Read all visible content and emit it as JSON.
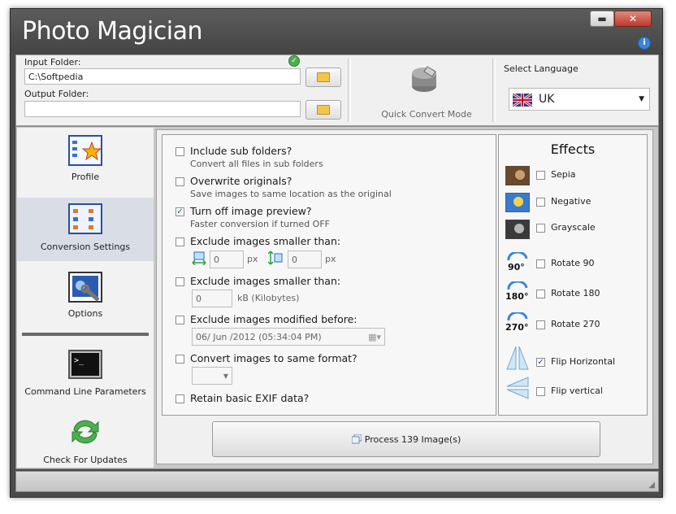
{
  "app": {
    "title": "Photo Magician"
  },
  "window_controls": {
    "minimize": "▬",
    "close": "✕",
    "info": "i"
  },
  "top": {
    "input_folder_label": "Input Folder:",
    "input_folder_value": "C:\\Softpedia",
    "output_folder_label": "Output Folder:",
    "output_folder_value": "",
    "quick_convert_label": "Quick Convert Mode",
    "language_label": "Select Language",
    "language_value": "UK"
  },
  "sidebar": {
    "items": [
      {
        "label": "Profile",
        "icon": "profile-icon",
        "active": false
      },
      {
        "label": "Conversion Settings",
        "icon": "conversion-settings-icon",
        "active": true
      },
      {
        "label": "Options",
        "icon": "options-icon",
        "active": false
      },
      {
        "label": "Command Line Parameters",
        "icon": "terminal-icon",
        "active": false
      },
      {
        "label": "Check For Updates",
        "icon": "refresh-icon",
        "active": false
      }
    ]
  },
  "options": [
    {
      "title": "Include sub folders?",
      "sub": "Convert all files in sub folders",
      "checked": false
    },
    {
      "title": "Overwrite originals?",
      "sub": "Save images to same location as the original",
      "checked": false
    },
    {
      "title": "Turn off image preview?",
      "sub": "Faster conversion if turned OFF",
      "checked": true
    },
    {
      "title": "Exclude images smaller than:",
      "width_value": "0",
      "height_value": "0",
      "unit": "px",
      "checked": false
    },
    {
      "title": "Exclude images smaller than:",
      "size_value": "0",
      "unit": "kB (Kilobytes)",
      "checked": false
    },
    {
      "title": "Exclude images modified before:",
      "date_value": "06/ Jun /2012 (05:34:04 PM)",
      "checked": false
    },
    {
      "title": "Convert images to same format?",
      "format_value": "",
      "checked": false
    },
    {
      "title": "Retain basic EXIF data?",
      "checked": false
    }
  ],
  "effects": {
    "title": "Effects",
    "items": [
      {
        "label": "Sepia",
        "checked": false,
        "icon": "sepia-thumb"
      },
      {
        "label": "Negative",
        "checked": false,
        "icon": "negative-thumb"
      },
      {
        "label": "Grayscale",
        "checked": false,
        "icon": "grayscale-thumb"
      },
      {
        "label": "Rotate 90",
        "checked": false,
        "icon": "rotate-90-icon",
        "badge": "90°"
      },
      {
        "label": "Rotate 180",
        "checked": false,
        "icon": "rotate-180-icon",
        "badge": "180°"
      },
      {
        "label": "Rotate 270",
        "checked": false,
        "icon": "rotate-270-icon",
        "badge": "270°"
      },
      {
        "label": "Flip Horizontal",
        "checked": true,
        "icon": "flip-horizontal-icon"
      },
      {
        "label": "Flip vertical",
        "checked": false,
        "icon": "flip-vertical-icon"
      }
    ]
  },
  "process_button": {
    "label": "Process 139 Image(s)"
  },
  "colors": {
    "frame": "#4a4a4a",
    "panel": "#f0f0f0",
    "active_nav": "#d9dde6",
    "accent_blue": "#3a86d6"
  }
}
